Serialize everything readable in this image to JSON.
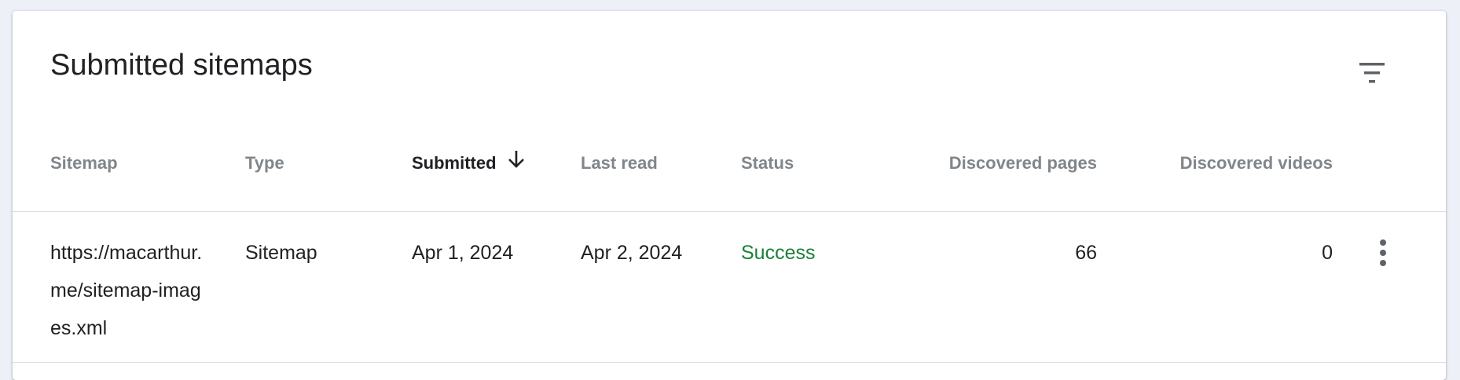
{
  "card": {
    "title": "Submitted sitemaps",
    "filter_icon": "filter-list-icon"
  },
  "table": {
    "columns": [
      {
        "key": "sitemap",
        "label": "Sitemap"
      },
      {
        "key": "type",
        "label": "Type"
      },
      {
        "key": "submitted",
        "label": "Submitted",
        "sorted": "descending",
        "sort_icon": "arrow-down-icon"
      },
      {
        "key": "last_read",
        "label": "Last read"
      },
      {
        "key": "status",
        "label": "Status"
      },
      {
        "key": "discovered_pages",
        "label": "Discovered pages"
      },
      {
        "key": "discovered_videos",
        "label": "Discovered videos"
      }
    ],
    "rows": [
      {
        "sitemap": "https://macarthur.me/sitemap-images.xml",
        "type": "Sitemap",
        "submitted": "Apr 1, 2024",
        "last_read": "Apr 2, 2024",
        "status": "Success",
        "discovered_pages": "66",
        "discovered_videos": "0",
        "more_icon": "more-vert-icon"
      }
    ]
  },
  "colors": {
    "background": "#eef0f7",
    "card": "#ffffff",
    "header_text": "#80868b",
    "active_header_text": "#202124",
    "status_success": "#188038",
    "divider": "#dadce0"
  }
}
